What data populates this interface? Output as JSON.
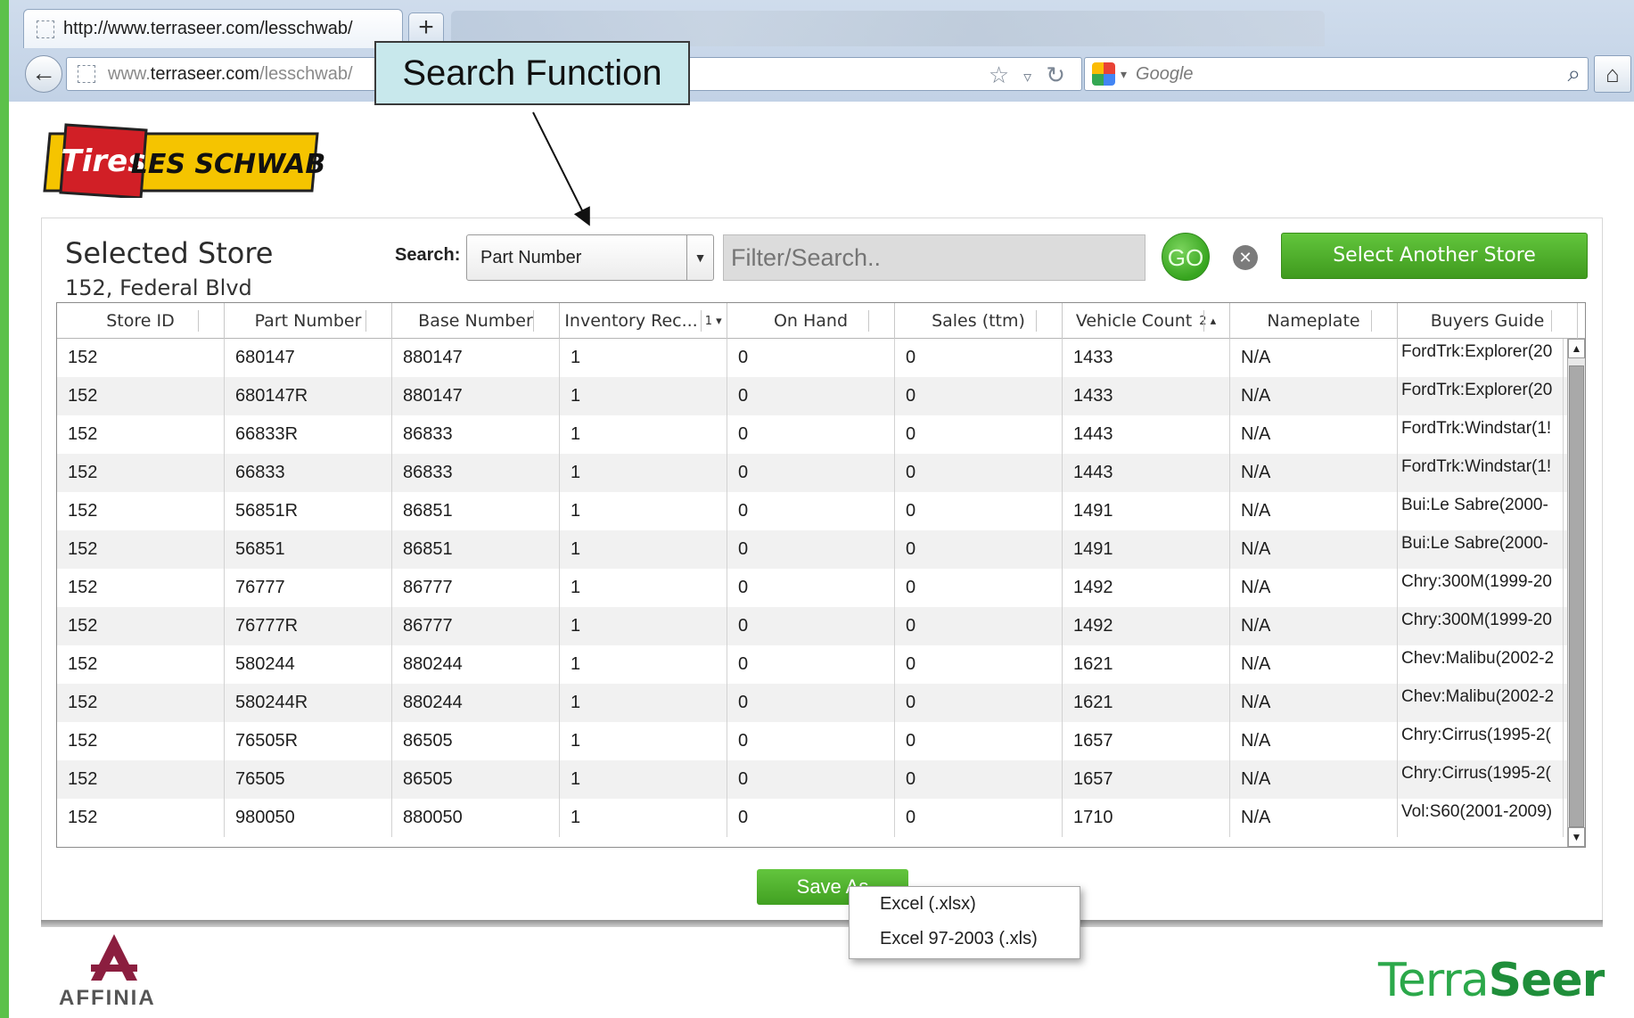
{
  "browser": {
    "tab_title": "http://www.terraseer.com/lesschwab/",
    "new_tab_label": "+",
    "url_prefix": "www.",
    "url_domain": "terraseer.com",
    "url_path": "/lesschwab/",
    "search_placeholder": "Google"
  },
  "annotation": {
    "label": "Search Function"
  },
  "header": {
    "selected_store_label": "Selected Store",
    "store_name": "152, Federal Blvd",
    "search_label": "Search:",
    "search_field_selected": "Part Number",
    "filter_placeholder": "Filter/Search..",
    "go_label": "GO",
    "clear_symbol": "✕",
    "select_another_label": "Select Another Store"
  },
  "grid": {
    "columns": [
      {
        "label": "Store ID",
        "sort": ""
      },
      {
        "label": "Part Number",
        "sort": ""
      },
      {
        "label": "Base Number",
        "sort": ""
      },
      {
        "label": "Inventory Rec...",
        "sort": "1 ▾"
      },
      {
        "label": "On Hand",
        "sort": ""
      },
      {
        "label": "Sales (ttm)",
        "sort": ""
      },
      {
        "label": "Vehicle Count",
        "sort": "2 ▴"
      },
      {
        "label": "Nameplate",
        "sort": ""
      },
      {
        "label": "Buyers Guide",
        "sort": ""
      }
    ],
    "rows": [
      [
        "152",
        "680147",
        "880147",
        "1",
        "0",
        "0",
        "1433",
        "N/A",
        "FordTrk:Explorer(20"
      ],
      [
        "152",
        "680147R",
        "880147",
        "1",
        "0",
        "0",
        "1433",
        "N/A",
        "FordTrk:Explorer(20"
      ],
      [
        "152",
        "66833R",
        "86833",
        "1",
        "0",
        "0",
        "1443",
        "N/A",
        "FordTrk:Windstar(1!"
      ],
      [
        "152",
        "66833",
        "86833",
        "1",
        "0",
        "0",
        "1443",
        "N/A",
        "FordTrk:Windstar(1!"
      ],
      [
        "152",
        "56851R",
        "86851",
        "1",
        "0",
        "0",
        "1491",
        "N/A",
        "Bui:Le Sabre(2000-"
      ],
      [
        "152",
        "56851",
        "86851",
        "1",
        "0",
        "0",
        "1491",
        "N/A",
        "Bui:Le Sabre(2000-"
      ],
      [
        "152",
        "76777",
        "86777",
        "1",
        "0",
        "0",
        "1492",
        "N/A",
        "Chry:300M(1999-20"
      ],
      [
        "152",
        "76777R",
        "86777",
        "1",
        "0",
        "0",
        "1492",
        "N/A",
        "Chry:300M(1999-20"
      ],
      [
        "152",
        "580244",
        "880244",
        "1",
        "0",
        "0",
        "1621",
        "N/A",
        "Chev:Malibu(2002-2"
      ],
      [
        "152",
        "580244R",
        "880244",
        "1",
        "0",
        "0",
        "1621",
        "N/A",
        "Chev:Malibu(2002-2"
      ],
      [
        "152",
        "76505R",
        "86505",
        "1",
        "0",
        "0",
        "1657",
        "N/A",
        "Chry:Cirrus(1995-2("
      ],
      [
        "152",
        "76505",
        "86505",
        "1",
        "0",
        "0",
        "1657",
        "N/A",
        "Chry:Cirrus(1995-2("
      ],
      [
        "152",
        "980050",
        "880050",
        "1",
        "0",
        "0",
        "1710",
        "N/A",
        "Vol:S60(2001-2009)"
      ]
    ]
  },
  "save": {
    "button_label": "Save As",
    "options": [
      "Excel (.xlsx)",
      "Excel 97-2003 (.xls)"
    ]
  },
  "footer": {
    "left_logo_text": "AFFINIA",
    "right_logo_part1": "Terra",
    "right_logo_part2": "Seer"
  },
  "brand": {
    "logo_word1": "Tires",
    "logo_word2": "LES SCHWAB",
    "accent_green": "#4caf2a",
    "logo_red": "#d11f26",
    "logo_yellow": "#f5c400"
  }
}
